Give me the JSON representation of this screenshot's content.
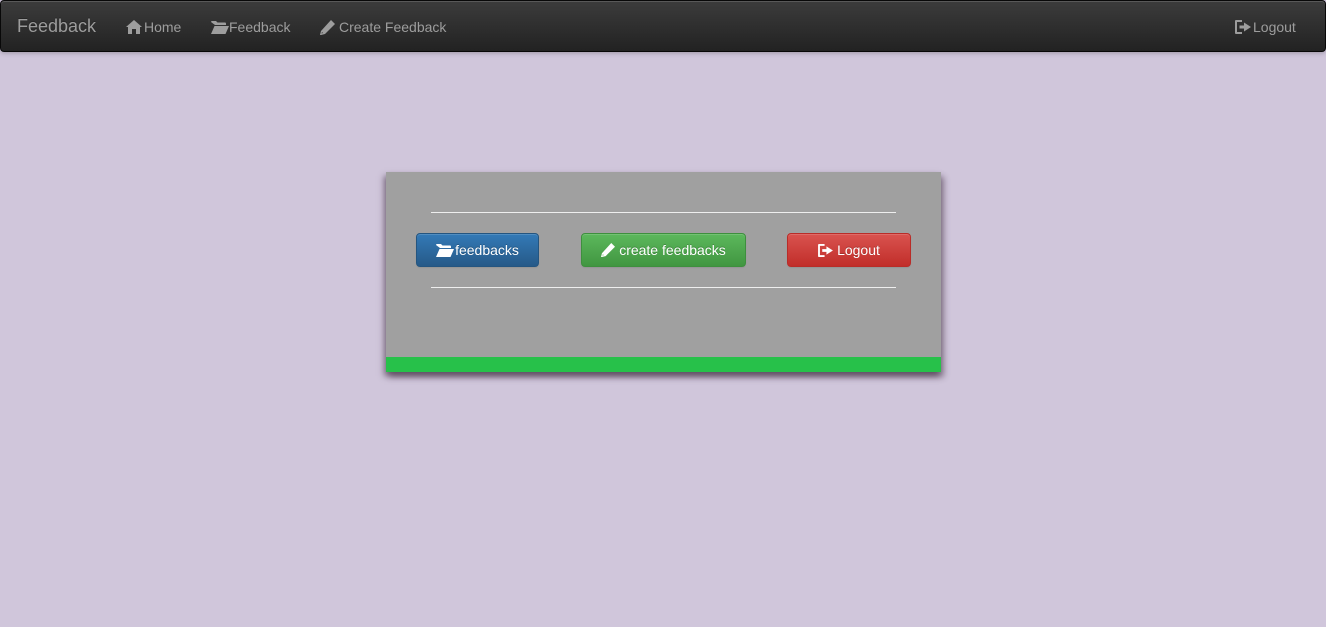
{
  "navbar": {
    "brand": "Feedback",
    "links": [
      {
        "label": "Home",
        "icon": "home-icon"
      },
      {
        "label": "Feedback",
        "icon": "folder-open-icon"
      },
      {
        "label": "Create Feedback",
        "icon": "pencil-icon"
      }
    ],
    "logout": {
      "label": "Logout",
      "icon": "logout-icon"
    }
  },
  "card": {
    "buttons": {
      "feedbacks": {
        "label": "feedbacks",
        "icon": "folder-open-icon",
        "color": "#337ab7"
      },
      "create": {
        "label": "create feedbacks",
        "icon": "pencil-icon",
        "color": "#5cb85c"
      },
      "logout": {
        "label": "Logout",
        "icon": "logout-icon",
        "color": "#d9534f"
      }
    },
    "accent_bar_color": "#27c14a"
  },
  "colors": {
    "page_background": "#d0c6db",
    "card_background": "#a0a0a0",
    "navbar_background": "#222222"
  }
}
